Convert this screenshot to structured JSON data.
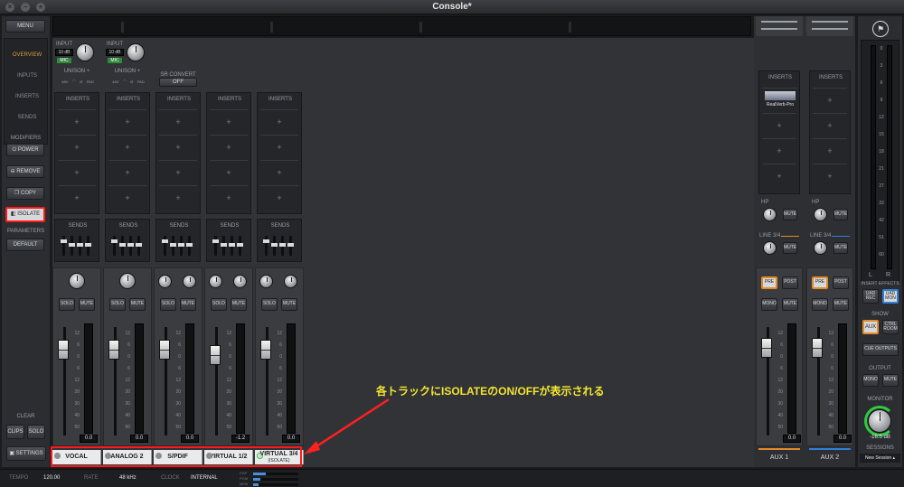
{
  "window": {
    "title": "Console*"
  },
  "sidebar": {
    "menu_label": "MENU",
    "nav": [
      "OVERVIEW",
      "INPUTS",
      "INSERTS",
      "SENDS"
    ],
    "modifiers_heading": "MODIFIERS",
    "modifiers": [
      "POWER",
      "REMOVE",
      "COPY",
      "ISOLATE"
    ],
    "parameters_heading": "PARAMETERS",
    "default_label": "DEFAULT",
    "clear_heading": "CLEAR",
    "clips_label": "CLIPS",
    "solo_label": "SOLO",
    "settings_label": "SETTINGS"
  },
  "channels": [
    {
      "name": "VOCAL",
      "input": "INPUT",
      "gain": "10 dB",
      "mic": "MIC",
      "unison": "UNISON +",
      "readout": "0.0"
    },
    {
      "name": "ANALOG 2",
      "input": "INPUT",
      "gain": "10 dB",
      "mic": "MIC",
      "unison": "UNISON +",
      "readout": "0.0"
    },
    {
      "name": "S/PDIF",
      "sr_convert": "SR CONVERT",
      "sr_state": "OFF",
      "readout": "0.0"
    },
    {
      "name": "VIRTUAL 1/2",
      "readout": "-1.2"
    },
    {
      "name": "VIRTUAL 3/4",
      "sub": "(ISOLATE)",
      "readout": "0.0"
    }
  ],
  "strip_labels": {
    "inserts": "INSERTS",
    "sends": "SENDS",
    "solo": "SOLO",
    "mute": "MUTE",
    "plus": "+",
    "mic_opts": "48V    ⌒    Ø    PAD"
  },
  "scale_ticks": [
    "12",
    "6",
    "0",
    "6",
    "12",
    "20",
    "30",
    "40",
    "50"
  ],
  "annotation": {
    "text": "各トラックにISOLATEのON/OFFが表示される",
    "color": "#f4e531"
  },
  "aux": [
    {
      "name": "AUX 1",
      "insert_plugin": "RealVerb-Pro",
      "readout": "0.0"
    },
    {
      "name": "AUX 2",
      "readout": "0.0"
    }
  ],
  "aux_labels": {
    "hp": "HP",
    "line": "LINE 3/4",
    "mute": "MUTE",
    "pre": "PRE",
    "post": "POST",
    "mono": "MONO",
    "mute2": "MUTE",
    "inserts": "INSERTS"
  },
  "monitor": {
    "meter_ticks": [
      "0",
      "3",
      "6",
      "9",
      "12",
      "15",
      "18",
      "21",
      "27",
      "33",
      "42",
      "51",
      "60"
    ],
    "left": "L",
    "right": "R",
    "insert_effects": "INSERT EFFECTS",
    "uad_rec": "UAD REC",
    "uad_mon": "UAD MON",
    "show": "SHOW",
    "aux": "AUX",
    "ctrl_room": "CTRL ROOM",
    "cue_outputs": "CUE OUTPUTS",
    "output": "OUTPUT",
    "mono": "MONO",
    "mute": "MUTE",
    "monitor_label": "MONITOR",
    "monitor_value": "-16.5 dB",
    "sessions": "SESSIONS",
    "session_name": "New Session"
  },
  "status": {
    "tempo_label": "TEMPO",
    "tempo": "120.00",
    "rate_label": "RATE",
    "rate": "48 kHz",
    "clock_label": "CLOCK",
    "clock": "INTERNAL",
    "dsp": "DSP",
    "pgm": "PGM",
    "mem": "MEM"
  },
  "colors": {
    "accent_red": "#ff1a1a",
    "overview_orange": "#e09a3a",
    "aux1_line": "#e08a2a",
    "aux2_line": "#2f7fd6",
    "monitor_green": "#2ecc40"
  }
}
